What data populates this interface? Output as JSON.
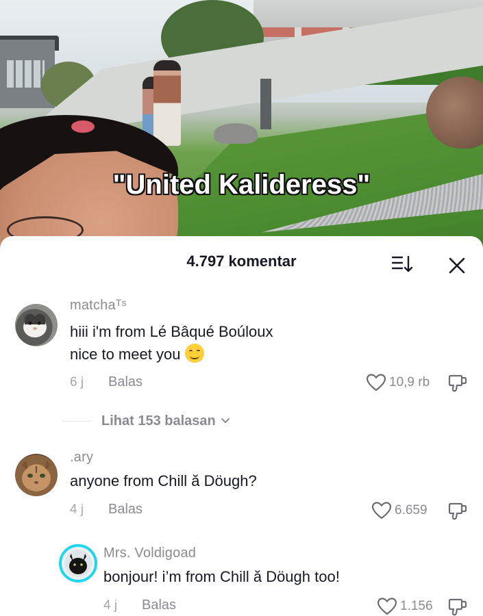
{
  "video": {
    "caption": "\"United Kalideress\""
  },
  "comments_panel": {
    "title": "4.797 komentar",
    "sort_icon": "sort-icon",
    "close_icon": "close-icon"
  },
  "comments": [
    {
      "username": "matchaᵀˢ",
      "line1": "hiii i'm from Lé Bâqué Boúloux",
      "line2": "nice to meet you",
      "emoji": "smiling-face-emoji",
      "time": "6 j",
      "reply_label": "Balas",
      "likes": "10,9 rb",
      "view_replies": "Lihat 153 balasan"
    },
    {
      "username": ".ary",
      "line1": "anyone from Chill ă Döugh?",
      "time": "4 j",
      "reply_label": "Balas",
      "likes": "6.659"
    },
    {
      "username": "Mrs. Voldigoad",
      "line1": "bonjour! i’m from Chill ă Döugh too!",
      "time": "4 j",
      "reply_label": "Balas",
      "likes": "1.156"
    }
  ],
  "colors": {
    "text_primary": "#161823",
    "text_secondary": "#8a8b91",
    "avatar_ring": "#20d5ec"
  }
}
